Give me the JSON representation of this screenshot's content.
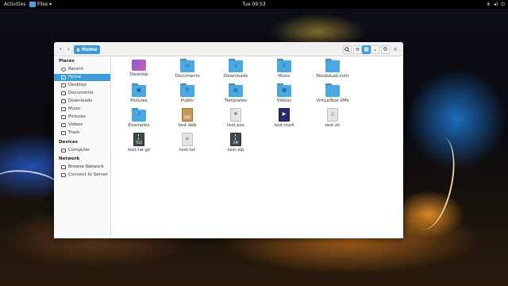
{
  "topbar": {
    "activities": "Activities",
    "app_menu": "Files ▾",
    "clock": "Tue 09:53"
  },
  "window": {
    "path_button": "Home",
    "close_glyph": "×"
  },
  "sidebar": {
    "sections": {
      "places": "Places",
      "devices": "Devices",
      "network": "Network"
    },
    "places": [
      {
        "label": "Recent",
        "icon": "clock-icon"
      },
      {
        "label": "Home",
        "icon": "home-icon",
        "active": true
      },
      {
        "label": "Desktop",
        "icon": "desktop-icon"
      },
      {
        "label": "Documents",
        "icon": "documents-icon"
      },
      {
        "label": "Downloads",
        "icon": "downloads-icon"
      },
      {
        "label": "Music",
        "icon": "music-icon"
      },
      {
        "label": "Pictures",
        "icon": "pictures-icon"
      },
      {
        "label": "Videos",
        "icon": "videos-icon"
      },
      {
        "label": "Trash",
        "icon": "trash-icon"
      }
    ],
    "devices": [
      {
        "label": "Computer",
        "icon": "computer-icon"
      }
    ],
    "network": [
      {
        "label": "Browse Network",
        "icon": "network-icon"
      },
      {
        "label": "Connect to Server",
        "icon": "server-icon"
      }
    ]
  },
  "files": [
    {
      "name": "Desktop",
      "icon": "desktop-folder-icon"
    },
    {
      "name": "Documents",
      "icon": "folder-icon"
    },
    {
      "name": "Downloads",
      "icon": "download-folder-icon"
    },
    {
      "name": "Music",
      "icon": "music-folder-icon"
    },
    {
      "name": "NoobsLab.com",
      "icon": "folder-icon"
    },
    {
      "name": "Pictures",
      "icon": "pictures-folder-icon"
    },
    {
      "name": "Public",
      "icon": "public-folder-icon"
    },
    {
      "name": "Templates",
      "icon": "templates-folder-icon"
    },
    {
      "name": "Videos",
      "icon": "videos-folder-icon"
    },
    {
      "name": "VirtualBox VMs",
      "icon": "folder-icon"
    },
    {
      "name": "Examples",
      "icon": "examples-folder-icon"
    },
    {
      "name": "test.deb",
      "icon": "deb-file-icon"
    },
    {
      "name": "test.exe",
      "icon": "exe-file-icon"
    },
    {
      "name": "test.mp4",
      "icon": "video-file-icon"
    },
    {
      "name": "test.sh",
      "icon": "script-file-icon"
    },
    {
      "name": "test.tar.gz",
      "icon": "archive-file-icon"
    },
    {
      "name": "test.txt",
      "icon": "text-file-icon"
    },
    {
      "name": "test.zip",
      "icon": "zip-file-icon"
    }
  ],
  "colors": {
    "accent": "#3d9bd8",
    "folder": "#4aa7e0"
  }
}
